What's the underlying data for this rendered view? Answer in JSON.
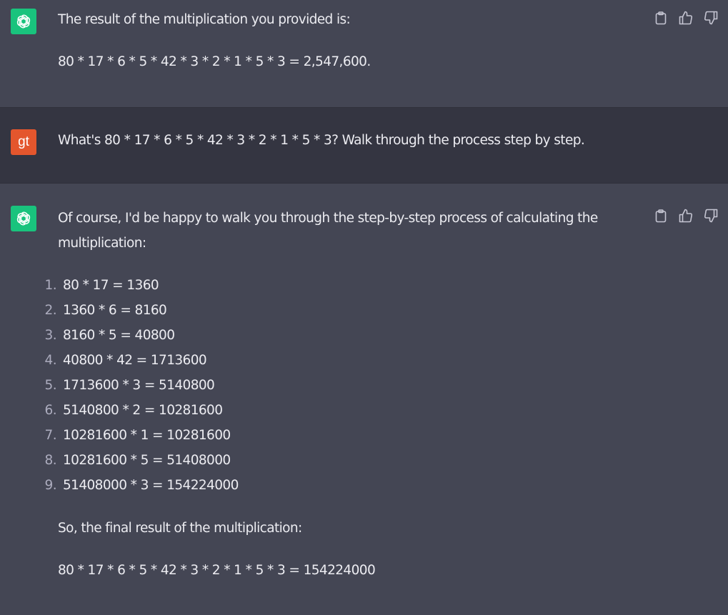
{
  "messages": [
    {
      "role": "assistant",
      "paragraphs": [
        "The result of the multiplication you provided is:",
        "80 * 17 * 6 * 5 * 42 * 3 * 2 * 1 * 5 * 3 = 2,547,600."
      ]
    },
    {
      "role": "user",
      "avatar_text": "gt",
      "text": "What's 80 * 17 * 6 * 5 * 42 * 3 * 2 * 1 * 5 * 3? Walk through the process step by step."
    },
    {
      "role": "assistant",
      "intro": "Of course, I'd be happy to walk you through the step-by-step process of calculating the multiplication:",
      "steps": [
        {
          "num": "1.",
          "expr": "80 * 17 = 1360"
        },
        {
          "num": "2.",
          "expr": "1360 * 6 = 8160"
        },
        {
          "num": "3.",
          "expr": "8160 * 5 = 40800"
        },
        {
          "num": "4.",
          "expr": "40800 * 42 = 1713600"
        },
        {
          "num": "5.",
          "expr": "1713600 * 3 = 5140800"
        },
        {
          "num": "6.",
          "expr": "5140800 * 2 = 10281600"
        },
        {
          "num": "7.",
          "expr": "10281600 * 1 = 10281600"
        },
        {
          "num": "8.",
          "expr": "10281600 * 5 = 51408000"
        },
        {
          "num": "9.",
          "expr": "51408000 * 3 = 154224000"
        }
      ],
      "summary": "So, the final result of the multiplication:",
      "final": "80 * 17 * 6 * 5 * 42 * 3 * 2 * 1 * 5 * 3 = 154224000"
    }
  ],
  "icons": {
    "assistant_avatar": "openai-logo-icon",
    "copy": "clipboard-icon",
    "like": "thumbs-up-icon",
    "dislike": "thumbs-down-icon"
  },
  "colors": {
    "assistant_bg": "#444654",
    "user_bg": "#343541",
    "assistant_avatar_bg": "#19c37d",
    "user_avatar_bg": "#e4562d",
    "text": "#ececf1",
    "icon": "#c5c5d2"
  }
}
